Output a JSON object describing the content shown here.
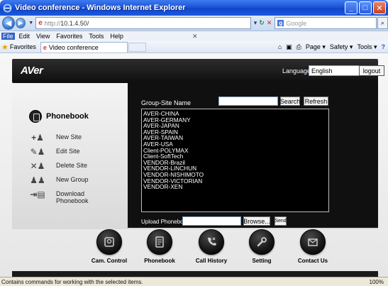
{
  "window": {
    "title": "Video conference - Windows Internet Explorer",
    "controls": [
      "_",
      "□",
      "✕"
    ]
  },
  "address": {
    "url_proto": "http://",
    "url_host": "10.1.4.50/",
    "search_placeholder": "Google",
    "search_logo": "g"
  },
  "menu": {
    "items": [
      "File",
      "Edit",
      "View",
      "Favorites",
      "Tools",
      "Help"
    ]
  },
  "favorites": {
    "label": "Favorites",
    "tab_title": "Video conference",
    "commands": [
      "Page ▾",
      "Safety ▾",
      "Tools ▾"
    ]
  },
  "status": {
    "text": "Contains commands for working with the selected items.",
    "zoom": "100%"
  },
  "header": {
    "logo": "AVer",
    "language_label": "Language",
    "language_value": "English",
    "logout_label": "logout"
  },
  "sidebar": {
    "title": "Phonebook",
    "items": [
      {
        "label": "New Site",
        "icon": "add-person-icon"
      },
      {
        "label": "Edit Site",
        "icon": "edit-person-icon"
      },
      {
        "label": "Delete Site",
        "icon": "delete-person-icon"
      },
      {
        "label": "New Group",
        "icon": "group-icon"
      },
      {
        "label": "Download Phonebook",
        "icon": "download-icon"
      }
    ]
  },
  "panel": {
    "group_site_label": "Group-Site Name",
    "group_site_value": "",
    "search_label": "Search",
    "refresh_label": "Refresh",
    "sites": [
      "AVER-CHINA",
      "AVER-GERMANY",
      "AVER-JAPAN",
      "AVER-SPAIN",
      "AVER-TAIWAN",
      "AVER-USA",
      "Client-POLYMAX",
      "Client-SoftTech",
      "VENDOR-Brazil",
      "VENDOR-LINCHUN",
      "VENDOR-NISHIMOTO",
      "VENDOR-VICTORIAN",
      "VENDOR-XEN"
    ],
    "upload_label": "Upload Phonebook",
    "browse_label": "Browse...",
    "send_label": "Send"
  },
  "bottom_nav": [
    {
      "label": "Cam. Control",
      "icon": "camera-icon"
    },
    {
      "label": "Phonebook",
      "icon": "phonebook-icon"
    },
    {
      "label": "Call History",
      "icon": "call-history-icon"
    },
    {
      "label": "Setting",
      "icon": "wrench-icon"
    },
    {
      "label": "Contact Us",
      "icon": "envelope-icon"
    }
  ]
}
